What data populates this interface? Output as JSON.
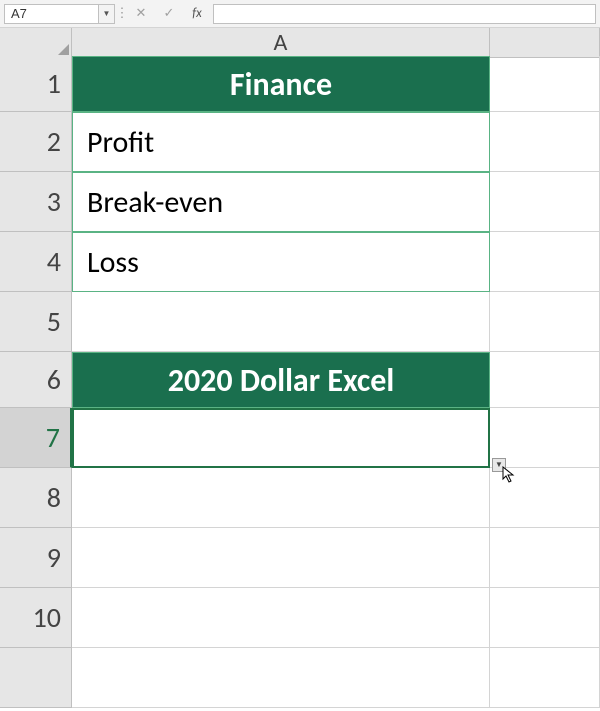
{
  "formulaBar": {
    "nameBox": "A7",
    "fxLabel": "fx",
    "formulaValue": ""
  },
  "columns": [
    "A"
  ],
  "rows": [
    "1",
    "2",
    "3",
    "4",
    "5",
    "6",
    "7",
    "8",
    "9",
    "10"
  ],
  "cells": {
    "A1": "Finance",
    "A2": "Profit",
    "A3": "Break-even",
    "A4": "Loss",
    "A5": "",
    "A6": "2020 Dollar Excel",
    "A7": "",
    "A8": "",
    "A9": "",
    "A10": ""
  },
  "activeCell": "A7",
  "colors": {
    "headerGreen": "#1a6f4e",
    "borderGreen": "#5ab384",
    "selectionGreen": "#217346"
  }
}
